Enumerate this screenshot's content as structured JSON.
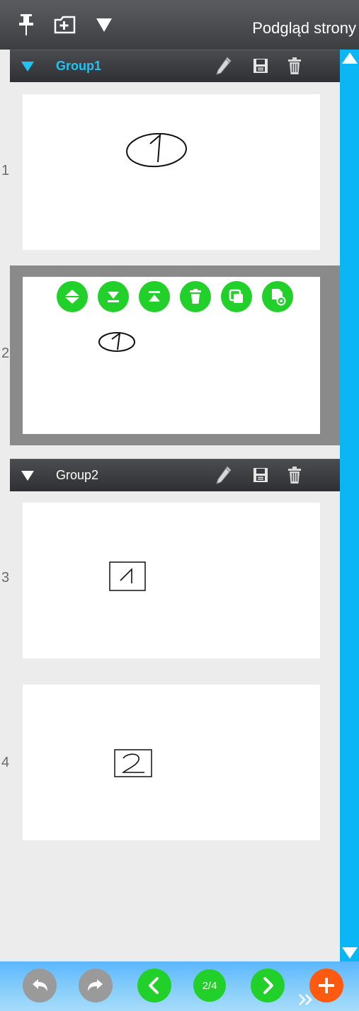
{
  "toolbar": {
    "title": "Podgląd strony",
    "icons": [
      "pin-icon",
      "add-page-icon",
      "dropdown-triangle-icon"
    ]
  },
  "groups": [
    {
      "name": "Group1",
      "expanded": true,
      "actions": [
        "edit-icon",
        "save-icon",
        "trash-icon"
      ],
      "pages": [
        {
          "number": "1",
          "content": "handwritten 1 in oval"
        },
        {
          "number": "2",
          "content": "handwritten 1 in small oval",
          "selected": true
        }
      ]
    },
    {
      "name": "Group2",
      "expanded": true,
      "actions": [
        "edit-icon",
        "save-icon",
        "trash-icon"
      ],
      "pages": [
        {
          "number": "3",
          "content": "handwritten 1 in box"
        },
        {
          "number": "4",
          "content": "handwritten 2 in box"
        }
      ]
    }
  ],
  "page_context_actions": [
    "move-icon",
    "move-to-bottom-icon",
    "move-to-top-icon",
    "delete-icon",
    "duplicate-icon",
    "page-settings-icon"
  ],
  "navigation": {
    "page_indicator": "2/4",
    "buttons": [
      "undo-icon",
      "redo-icon",
      "previous-icon",
      "next-icon",
      "add-icon"
    ]
  },
  "colors": {
    "toolbar_bg": "#45474b",
    "accent_blue": "#0ab6f3",
    "group_active_text": "#1ec4f4",
    "green": "#22d02a",
    "orange": "#ff5a10",
    "gray_button": "#9a9a9a"
  }
}
